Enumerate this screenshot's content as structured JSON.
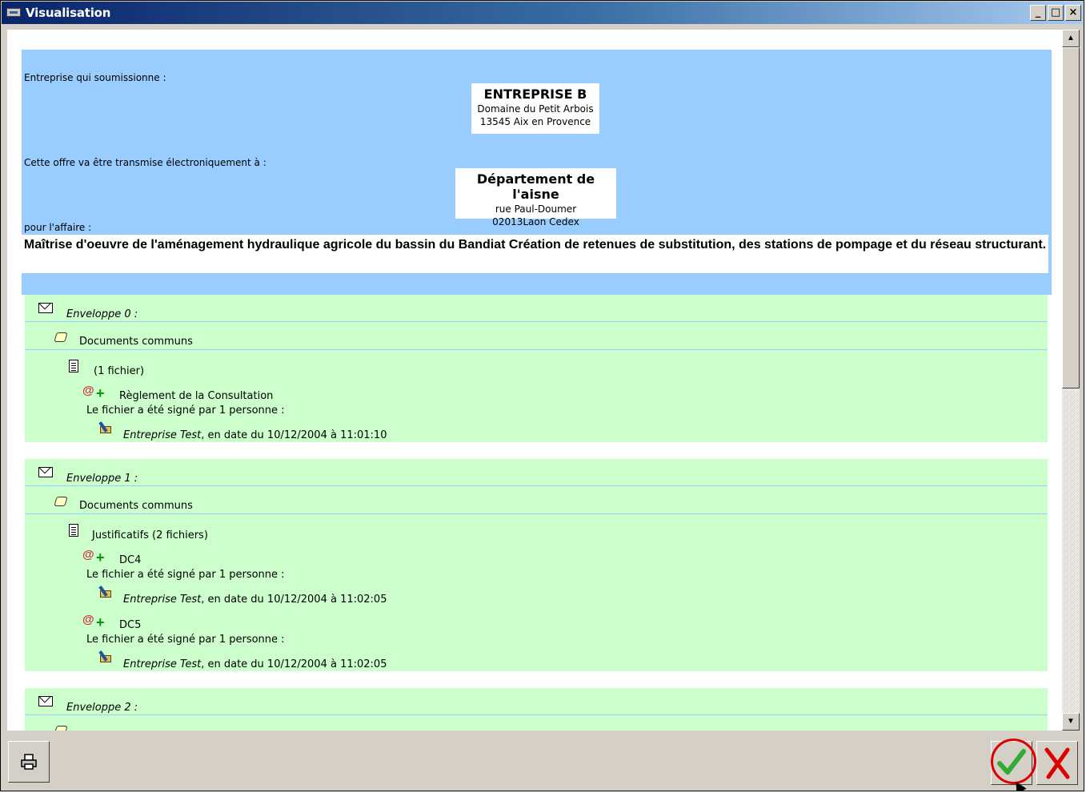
{
  "window": {
    "title": "Visualisation",
    "btn_min": "_",
    "btn_max": "□",
    "btn_close": "×"
  },
  "header": {
    "submitter_label": "Entreprise qui soumissionne :",
    "submitter": {
      "name": "ENTREPRISE B",
      "line1": "Domaine du Petit Arbois",
      "line2": "13545 Aix en Provence"
    },
    "transmit_label": "Cette offre va être transmise électroniquement à :",
    "recipient": {
      "name": "Département de l'aisne",
      "line1": "rue Paul-Doumer",
      "line2": "02013Laon Cedex"
    },
    "affaire_label": "pour l'affaire :",
    "affaire_title": "Maîtrise d'oeuvre de l'aménagement hydraulique agricole du bassin du Bandiat Création de retenues de substitution, des stations de pompage et du réseau structurant."
  },
  "envelopes": [
    {
      "label": "Enveloppe 0 :",
      "section": "Documents communs",
      "group": "(1 fichier)",
      "files": [
        {
          "name": "Règlement de la Consultation",
          "signed_text": "Le fichier a été signé par 1 personne :",
          "signer": "Entreprise Test",
          "signed_date": ", en date du 10/12/2004 à 11:01:10"
        }
      ]
    },
    {
      "label": "Enveloppe 1 :",
      "section": "Documents communs",
      "group": "Justificatifs (2 fichiers)",
      "files": [
        {
          "name": "DC4",
          "signed_text": "Le fichier a été signé par 1 personne :",
          "signer": "Entreprise Test",
          "signed_date": ", en date du 10/12/2004 à 11:02:05"
        },
        {
          "name": "DC5",
          "signed_text": "Le fichier a été signé par 1 personne :",
          "signer": "Entreprise Test",
          "signed_date": ", en date du 10/12/2004 à 11:02:05"
        }
      ]
    },
    {
      "label": "Enveloppe 2 :"
    }
  ],
  "icons": {
    "print": "printer-icon",
    "ok": "checkmark-icon",
    "cancel": "close-icon"
  },
  "colors": {
    "header_bg": "#99ccff",
    "envelope_bg": "#ccffcc",
    "ok": "#33aa33",
    "cancel": "#dd0000"
  }
}
